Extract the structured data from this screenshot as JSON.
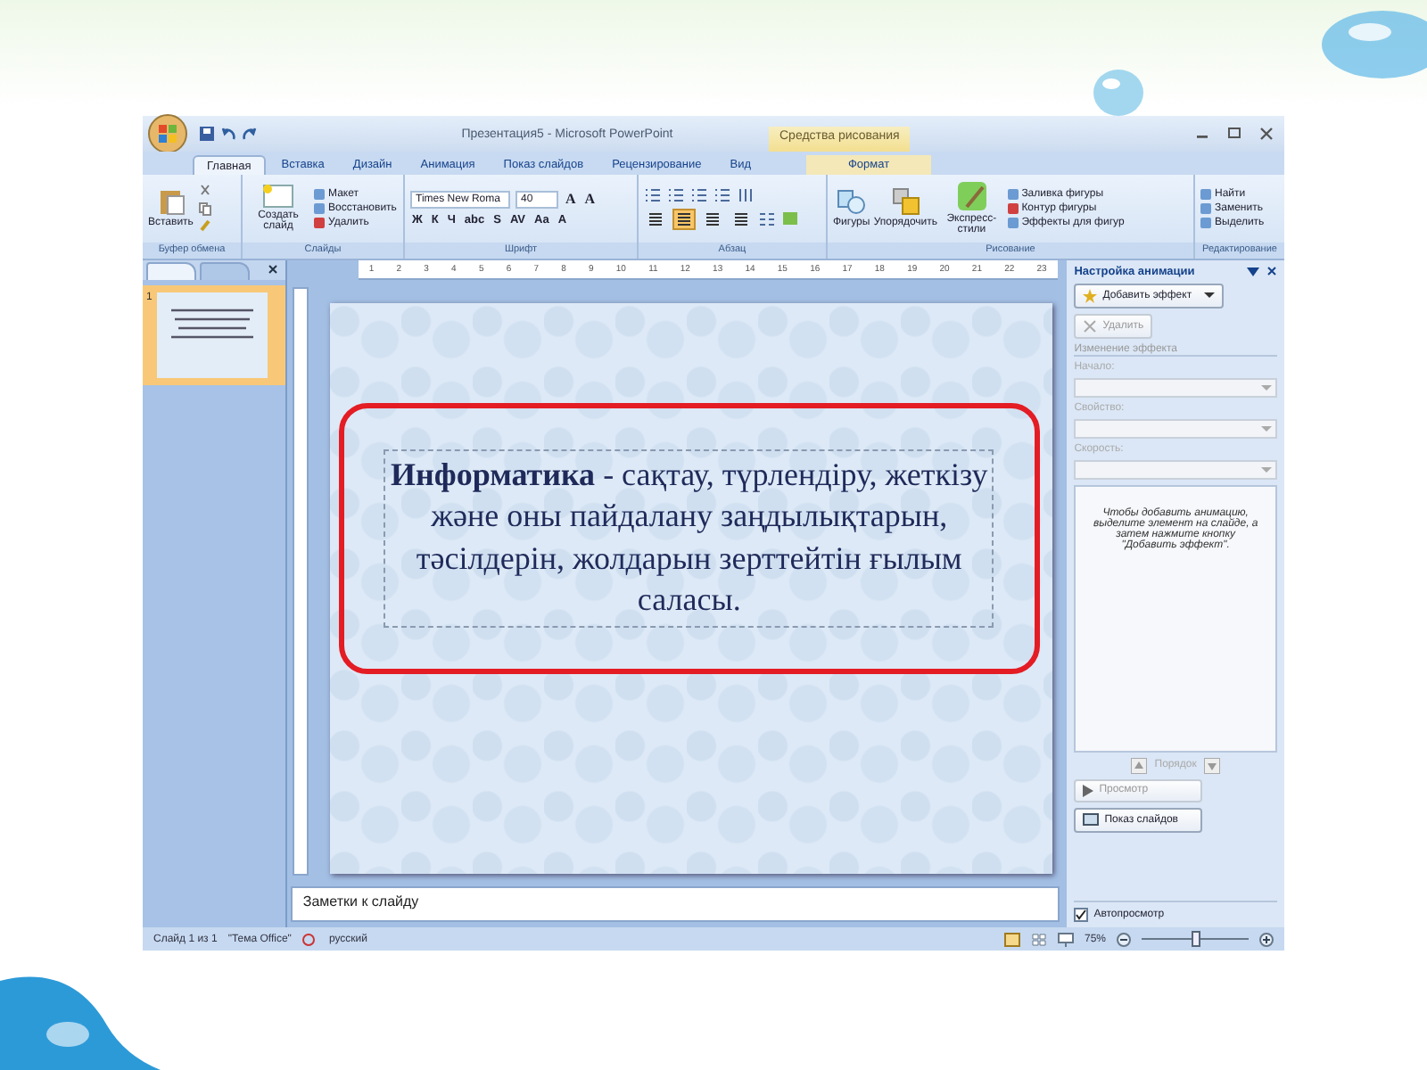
{
  "title_bar": {
    "title": "Презентация5 - Microsoft PowerPoint",
    "context_label": "Средства рисования"
  },
  "tabs": [
    {
      "label": "Главная",
      "selected": true,
      "contextual": false
    },
    {
      "label": "Вставка",
      "selected": false,
      "contextual": false
    },
    {
      "label": "Дизайн",
      "selected": false,
      "contextual": false
    },
    {
      "label": "Анимация",
      "selected": false,
      "contextual": false
    },
    {
      "label": "Показ слайдов",
      "selected": false,
      "contextual": false
    },
    {
      "label": "Рецензирование",
      "selected": false,
      "contextual": false
    },
    {
      "label": "Вид",
      "selected": false,
      "contextual": false
    },
    {
      "label": "Формат",
      "selected": false,
      "contextual": true
    }
  ],
  "ribbon": {
    "clipboard": {
      "label": "Буфер обмена",
      "paste": "Вставить"
    },
    "slides": {
      "label": "Слайды",
      "new_slide": "Создать слайд",
      "layout": "Макет",
      "reset": "Восстановить",
      "delete": "Удалить"
    },
    "font": {
      "label": "Шрифт",
      "family": "Times New Roma",
      "size": "40",
      "size_buttons": [
        "A",
        "A"
      ],
      "format_buttons": [
        "Ж",
        "К",
        "Ч",
        "abc",
        "S",
        "AV",
        "Aa",
        "A"
      ]
    },
    "paragraph": {
      "label": "Абзац",
      "align": [
        {
          "selected": false
        },
        {
          "selected": true
        },
        {
          "selected": false
        },
        {
          "selected": false
        }
      ]
    },
    "drawing": {
      "label": "Рисование",
      "shapes": "Фигуры",
      "arrange": "Упорядочить",
      "quick_styles": "Экспресс-стили",
      "fill": "Заливка фигуры",
      "outline": "Контур фигуры",
      "effects": "Эффекты для фигур"
    },
    "editing": {
      "label": "Редактирование",
      "find": "Найти",
      "replace": "Заменить",
      "select": "Выделить"
    }
  },
  "left_panel": {
    "tabs": [
      {
        "selected": true
      },
      {
        "selected": false
      }
    ],
    "thumbnails": [
      {
        "number": "1",
        "selected": true
      }
    ]
  },
  "ruler": {
    "labels": [
      "1",
      "2",
      "3",
      "4",
      "5",
      "6",
      "7",
      "8",
      "9",
      "10",
      "11",
      "12",
      "13",
      "14",
      "15",
      "16",
      "17",
      "18",
      "19",
      "20",
      "21",
      "22",
      "23"
    ]
  },
  "slide": {
    "text": "**Информатика** - сақтау, түрлендіру, жеткізу және оны пайдалану заңдылықтарын, тәсілдерін, жолдарын зерттейтін ғылым саласы."
  },
  "notes": {
    "placeholder": "Заметки к слайду"
  },
  "task_pane": {
    "title": "Настройка анимации",
    "add_effect": "Добавить эффект",
    "remove": {
      "label": "Удалить",
      "disabled": true
    },
    "section": "Изменение эффекта",
    "fields": [
      {
        "label": "Начало:",
        "disabled": true
      },
      {
        "label": "Свойство:",
        "disabled": true
      },
      {
        "label": "Скорость:",
        "disabled": true
      }
    ],
    "hint": "Чтобы добавить анимацию, выделите элемент на слайде, а затем нажмите кнопку \"Добавить эффект\".",
    "order": "Порядок",
    "preview": {
      "label": "Просмотр",
      "disabled": true
    },
    "slideshow": "Показ слайдов",
    "autopreview": {
      "label": "Автопросмотр",
      "checked": true
    }
  },
  "status_bar": {
    "slide": "Слайд 1 из 1",
    "theme": "\"Тема Office\"",
    "language": "русский",
    "zoom": "75%",
    "zoom_slider": {
      "level": 0.5
    }
  }
}
